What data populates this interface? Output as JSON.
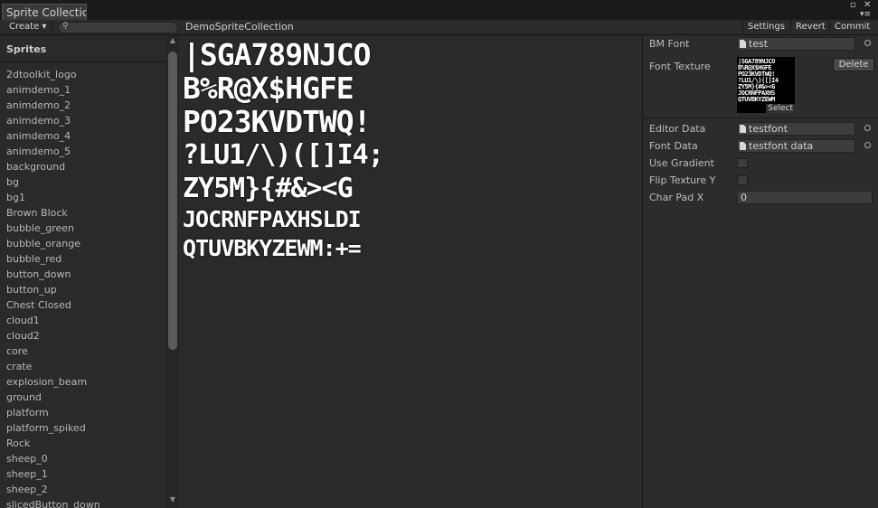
{
  "window": {
    "tab_title": "Sprite Collectic",
    "maximize_icon": "▫",
    "close_icon": "✕",
    "menu_icon": "▾≡"
  },
  "toolbar": {
    "create_label": "Create ▾",
    "search_icon": "⚲",
    "search_value": "",
    "collection_name": "DemoSpriteCollection",
    "settings_label": "Settings",
    "revert_label": "Revert",
    "commit_label": "Commit"
  },
  "sprites": {
    "header": "Sprites",
    "items": [
      "2dtoolkit_logo",
      "animdemo_1",
      "animdemo_2",
      "animdemo_3",
      "animdemo_4",
      "animdemo_5",
      "background",
      "bg",
      "bg1",
      "Brown Block",
      "bubble_green",
      "bubble_orange",
      "bubble_red",
      "button_down",
      "button_up",
      "Chest Closed",
      "cloud1",
      "cloud2",
      "core",
      "crate",
      "explosion_beam",
      "ground",
      "platform",
      "platform_spiked",
      "Rock",
      "sheep_0",
      "sheep_1",
      "sheep_2",
      "slicedButton_down"
    ]
  },
  "scrollbar": {
    "up_icon": "▲",
    "down_icon": "▼"
  },
  "preview": {
    "glyph_rows": [
      "|SGA789NJCO",
      "B%R@X$HGFE",
      "PO23KVDTWQ!",
      "?LU1/\\)([]I4;",
      "ZY5M}{#&><G",
      "JOCRNFPAXHSLDI",
      "QTUVBKYZEWM:+=",
      "*||~',^-`"
    ]
  },
  "inspector": {
    "bm_font": {
      "label": "BM Font",
      "value": "test"
    },
    "font_texture": {
      "label": "Font Texture",
      "select_label": "Select",
      "delete_label": "Delete",
      "thumb_text": "|SGA789NJCO\nB%R@X$HGFE\nPO23KVDTWQ!\n?LU1/\\)([]I4\nZY5M}{#&><G\nJOCRNFPAXHS\nQTUVBKYZEWM"
    },
    "editor_data": {
      "label": "Editor Data",
      "value": "testfont"
    },
    "font_data": {
      "label": "Font Data",
      "value": "testfont data"
    },
    "use_gradient": {
      "label": "Use Gradient",
      "checked": false
    },
    "flip_texture_y": {
      "label": "Flip Texture Y",
      "checked": false
    },
    "char_pad_x": {
      "label": "Char Pad X",
      "value": "0"
    }
  }
}
